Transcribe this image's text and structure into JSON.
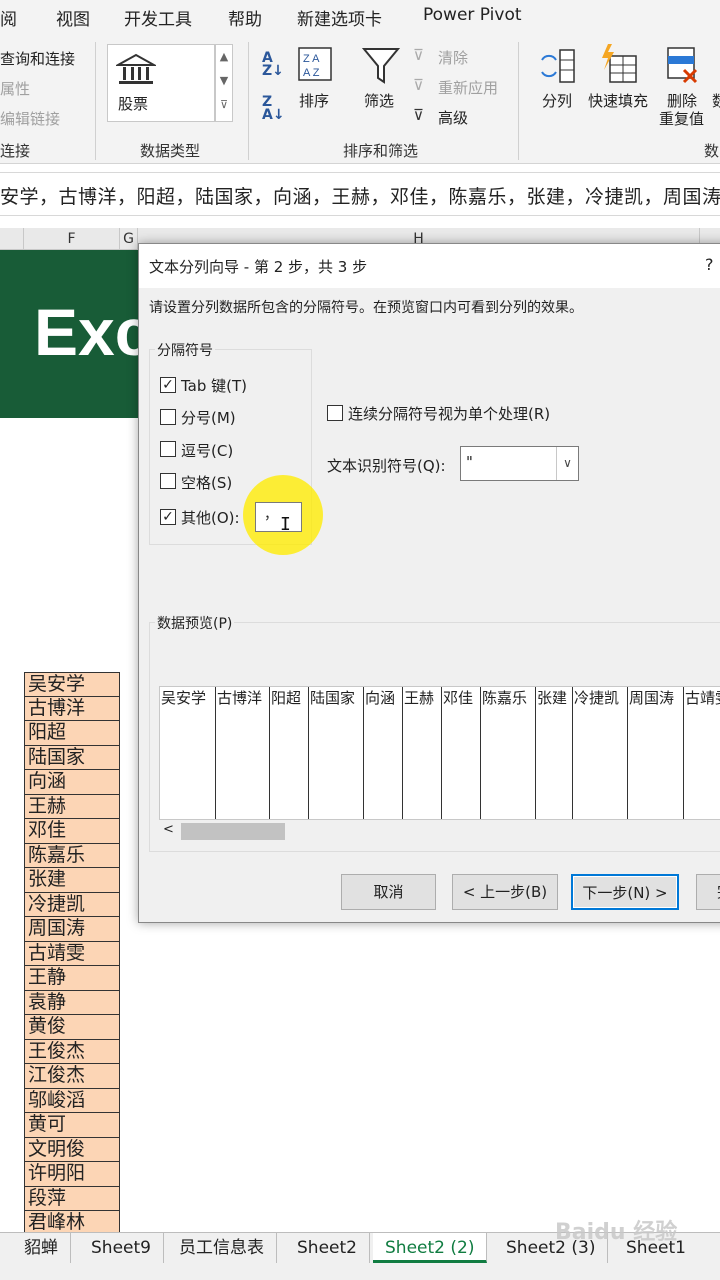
{
  "ribbon_tabs": [
    "阅",
    "视图",
    "开发工具",
    "帮助",
    "新建选项卡",
    "Power Pivot"
  ],
  "ribbon": {
    "connections": {
      "items": [
        "查询和连接",
        "属性",
        "编辑链接"
      ],
      "group_label": "连接"
    },
    "data_types": {
      "type_label": "股票",
      "group_label": "数据类型"
    },
    "sort_filter": {
      "sort_label": "排序",
      "filter_label": "筛选",
      "clear_label": "清除",
      "reapply_label": "重新应用",
      "advanced_label": "高级",
      "group_label": "排序和筛选"
    },
    "data_tools": {
      "split_label": "分列",
      "flash_fill_label": "快速填充",
      "remove_dup_label": "删除",
      "remove_dup_label2": "重复值",
      "partial_label": "数",
      "group_label": "数"
    }
  },
  "formula_bar": {
    "text": "安学，古博洋，阳超，陆国家，向涵，王赫，邓佳，陈嘉乐，张建，冷捷凯，周国涛"
  },
  "columns": [
    "F",
    "G",
    "H"
  ],
  "banner": {
    "text": "Exc"
  },
  "names": [
    "吴安学",
    "古博洋",
    "阳超",
    "陆国家",
    "向涵",
    "王赫",
    "邓佳",
    "陈嘉乐",
    "张建",
    "冷捷凯",
    "周国涛",
    "古靖雯",
    "王静",
    "袁静",
    "黄俊",
    "王俊杰",
    "江俊杰",
    "邬峻滔",
    "黄可",
    "文明俊",
    "许明阳",
    "段萍",
    "君峰林"
  ],
  "sheet_tabs": [
    "貂蝉",
    "Sheet9",
    "员工信息表",
    "Sheet2",
    "Sheet2 (2)",
    "Sheet2 (3)",
    "Sheet1"
  ],
  "active_sheet": "Sheet2 (2)",
  "dialog": {
    "title": "文本分列向导 - 第 2 步，共 3 步",
    "help": "?",
    "instruction": "请设置分列数据所包含的分隔符号。在预览窗口内可看到分列的效果。",
    "delimiters_label": "分隔符号",
    "delimiters": [
      {
        "label": "Tab 键(T)",
        "checked": true
      },
      {
        "label": "分号(M)",
        "checked": false
      },
      {
        "label": "逗号(C)",
        "checked": false
      },
      {
        "label": "空格(S)",
        "checked": false
      },
      {
        "label": "其他(O):",
        "checked": true
      }
    ],
    "other_value": "，",
    "consecutive_label": "连续分隔符号视为单个处理(R)",
    "consecutive_checked": false,
    "qualifier_label": "文本识别符号(Q):",
    "qualifier_value": "\"",
    "preview_label": "数据预览(P)",
    "preview_columns": [
      "吴安学",
      "古博洋",
      "阳超",
      "陆国家",
      "向涵",
      "王赫",
      "邓佳",
      "陈嘉乐",
      "张建",
      "冷捷凯",
      "周国涛",
      "古靖雯"
    ],
    "buttons": {
      "cancel": "取消",
      "back": "< 上一步(B)",
      "next": "下一步(N) >",
      "finish": "完"
    }
  },
  "watermark": "Baidu 经验"
}
